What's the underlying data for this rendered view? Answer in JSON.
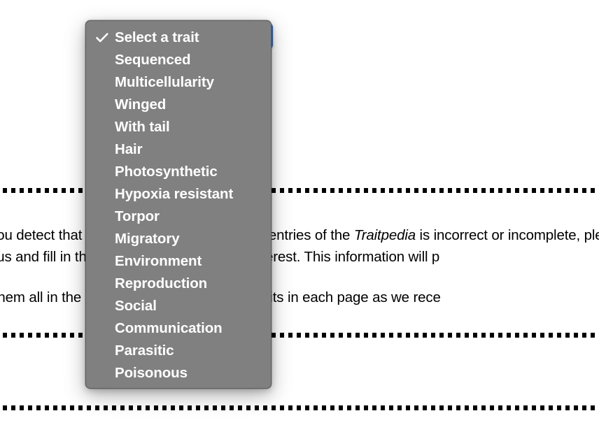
{
  "page": {
    "paragraphs": [
      {
        "id": "para-1",
        "segments": [
          {
            "text": "f you detect that the information on any of the entries of the ",
            "style": "normal"
          },
          {
            "text": "Traitpedia",
            "style": "italic"
          },
          {
            "text": " is incorrect or incomplete, please help us and fill the following form with the ",
            "style": "normal"
          },
          {
            "text": "species of interest. This information will p",
            "style": "normal"
          }
        ],
        "plain_line_1": "f you detect that the information on any of the entries of the Traitpedia is inc",
        "plain_line_2": "lp us and fill in the form with the species of interest. This information will p"
      },
      {
        "id": "para-2",
        "plain_line_1": "e them all in the database and include new traits in each page as we rece"
      }
    ],
    "rules": [
      {
        "name": "divider-top",
        "style": "dashed"
      },
      {
        "name": "divider-middle",
        "style": "dashed"
      },
      {
        "name": "divider-bottom",
        "style": "dashed"
      }
    ]
  },
  "select": {
    "name": "trait-select",
    "selected_value": "Select a trait",
    "highlight_color": "#1d6ff2",
    "menu_background": "#808080",
    "menu_text_color": "#ffffff"
  },
  "dropdown": {
    "checked_index": 0,
    "check_icon": "check-icon",
    "options": [
      {
        "label": "Select a trait",
        "checked": true
      },
      {
        "label": "Sequenced",
        "checked": false
      },
      {
        "label": "Multicellularity",
        "checked": false
      },
      {
        "label": "Winged",
        "checked": false
      },
      {
        "label": "With tail",
        "checked": false
      },
      {
        "label": "Hair",
        "checked": false
      },
      {
        "label": "Photosynthetic",
        "checked": false
      },
      {
        "label": "Hypoxia resistant",
        "checked": false
      },
      {
        "label": "Torpor",
        "checked": false
      },
      {
        "label": "Migratory",
        "checked": false
      },
      {
        "label": "Environment",
        "checked": false
      },
      {
        "label": "Reproduction",
        "checked": false
      },
      {
        "label": "Social",
        "checked": false
      },
      {
        "label": "Communication",
        "checked": false
      },
      {
        "label": "Parasitic",
        "checked": false
      },
      {
        "label": "Poisonous",
        "checked": false
      }
    ]
  }
}
